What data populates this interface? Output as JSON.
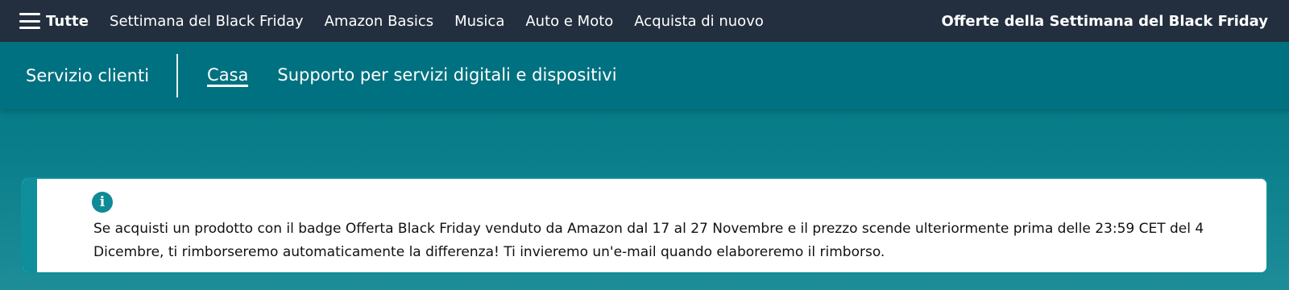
{
  "topnav": {
    "menu_label": "Tutte",
    "links": [
      "Settimana del Black Friday",
      "Amazon Basics",
      "Musica",
      "Auto e Moto",
      "Acquista di nuovo"
    ],
    "promo": "Offerte della Settimana del Black Friday"
  },
  "subnav": {
    "title": "Servizio clienti",
    "tabs": [
      {
        "label": "Casa",
        "active": true
      },
      {
        "label": "Supporto per servizi digitali e dispositivi",
        "active": false
      }
    ]
  },
  "alert": {
    "icon": "info-icon",
    "icon_glyph": "i",
    "text": "Se acquisti un prodotto con il badge Offerta Black Friday venduto da Amazon dal 17 al 27 Novembre e il prezzo scende ulteriormente prima delle 23:59 CET del 4 Dicembre, ti rimborseremo automaticamente la differenza! Ti invieremo un'e-mail quando elaboreremo il rimborso."
  },
  "colors": {
    "topnav_bg": "#232f3e",
    "subnav_bg": "#007180",
    "accent_teal": "#0f8f9b"
  }
}
